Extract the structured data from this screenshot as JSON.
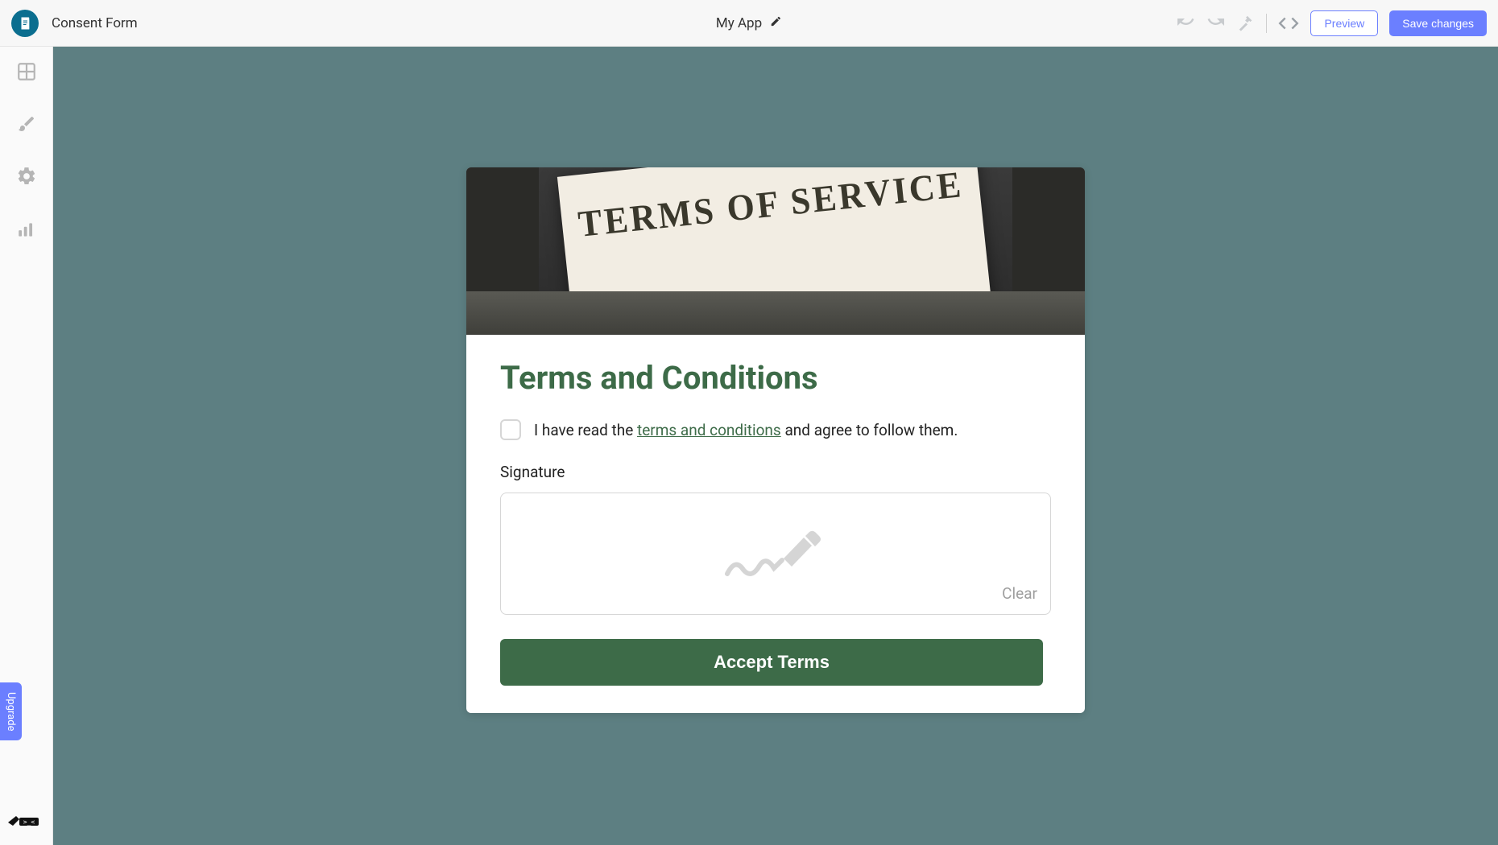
{
  "header": {
    "page_name": "Consent Form",
    "app_title": "My App",
    "preview_label": "Preview",
    "save_label": "Save changes"
  },
  "sidebar": {
    "upgrade_label": "Upgrade"
  },
  "form": {
    "hero_text": "TERMS OF SERVICE",
    "title": "Terms and Conditions",
    "consent_prefix": "I have read the ",
    "consent_link": "terms and conditions",
    "consent_suffix": " and agree to follow them.",
    "signature_label": "Signature",
    "clear_label": "Clear",
    "accept_label": "Accept Terms"
  },
  "colors": {
    "accent_green": "#3d6b48",
    "primary_blue": "#6b7fff",
    "canvas_bg": "#5d7f82"
  }
}
